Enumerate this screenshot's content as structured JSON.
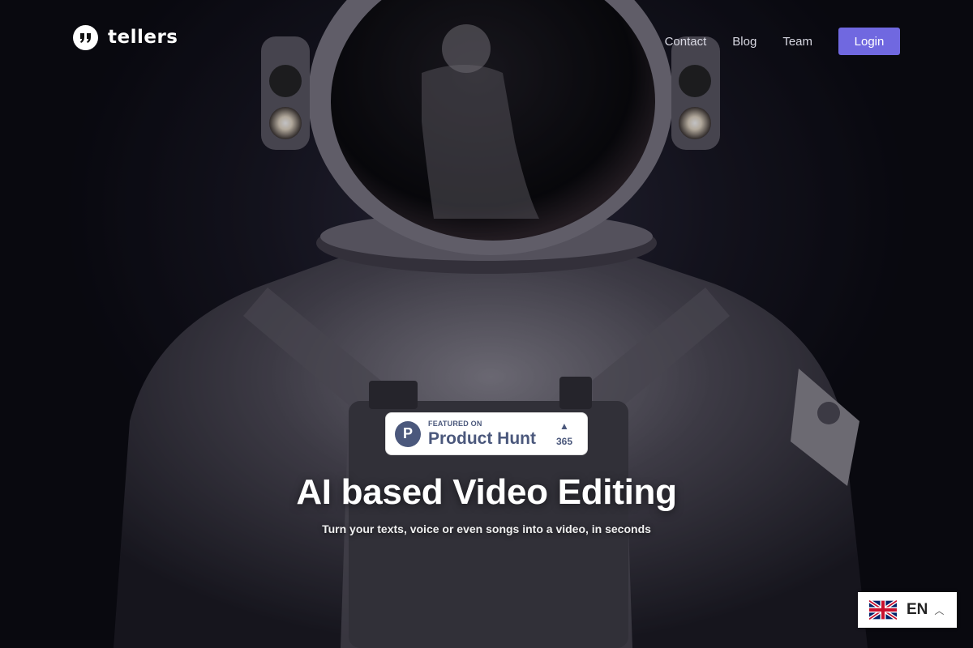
{
  "brand": {
    "name": "tellers"
  },
  "nav": {
    "links": [
      "Contact",
      "Blog",
      "Team"
    ],
    "login_label": "Login"
  },
  "badge": {
    "featured_on": "FEATURED ON",
    "name": "Product Hunt",
    "votes": "365"
  },
  "hero": {
    "title": "AI based Video Editing",
    "subtitle": "Turn your texts, voice or even songs into a video, in seconds"
  },
  "language": {
    "code": "EN"
  },
  "colors": {
    "accent": "#7068e0",
    "product_hunt": "#4b587c"
  }
}
